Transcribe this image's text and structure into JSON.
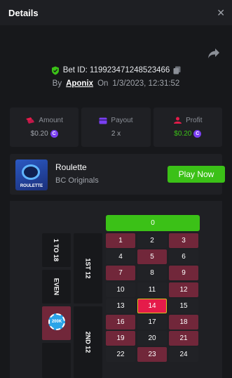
{
  "header": {
    "title": "Details",
    "close_glyph": "✕"
  },
  "bet": {
    "id_text": "Bet ID: 119923471248523466",
    "by_label": "By",
    "user": "Aponix",
    "on_label": "On",
    "date": "1/3/2023, 12:31:52"
  },
  "stats": {
    "amount": {
      "label": "Amount",
      "value": "$0.20"
    },
    "payout": {
      "label": "Payout",
      "value": "2 x"
    },
    "profit": {
      "label": "Profit",
      "value": "$0.20"
    }
  },
  "game": {
    "name": "Roulette",
    "provider": "BC Originals",
    "thumb_label": "ROULETTE",
    "play_label": "Play Now"
  },
  "board": {
    "zero": "0",
    "side_bets": [
      "1 TO 18",
      "EVEN"
    ],
    "dozens": [
      "1ST 12",
      "2ND 12"
    ],
    "chip_label": "200K",
    "selected": "14",
    "rows": [
      [
        {
          "n": "1",
          "c": "red"
        },
        {
          "n": "2",
          "c": "black"
        },
        {
          "n": "3",
          "c": "red"
        }
      ],
      [
        {
          "n": "4",
          "c": "black"
        },
        {
          "n": "5",
          "c": "red"
        },
        {
          "n": "6",
          "c": "black"
        }
      ],
      [
        {
          "n": "7",
          "c": "red"
        },
        {
          "n": "8",
          "c": "black"
        },
        {
          "n": "9",
          "c": "red"
        }
      ],
      [
        {
          "n": "10",
          "c": "black"
        },
        {
          "n": "11",
          "c": "black"
        },
        {
          "n": "12",
          "c": "red"
        }
      ],
      [
        {
          "n": "13",
          "c": "black"
        },
        {
          "n": "14",
          "c": "sel"
        },
        {
          "n": "15",
          "c": "black"
        }
      ],
      [
        {
          "n": "16",
          "c": "red"
        },
        {
          "n": "17",
          "c": "black"
        },
        {
          "n": "18",
          "c": "red"
        }
      ],
      [
        {
          "n": "19",
          "c": "red"
        },
        {
          "n": "20",
          "c": "black"
        },
        {
          "n": "21",
          "c": "red"
        }
      ],
      [
        {
          "n": "22",
          "c": "black"
        },
        {
          "n": "23",
          "c": "red"
        },
        {
          "n": "24",
          "c": "black"
        }
      ]
    ]
  },
  "colors": {
    "green": "#3bc117",
    "red_cell": "#71273a",
    "selected": "#e51b4a",
    "coin": "#7a3ff2"
  },
  "icons": [
    "close-icon",
    "share-icon",
    "shield-check-icon",
    "copy-icon",
    "amount-icon",
    "payout-icon",
    "profit-icon",
    "coin-icon"
  ]
}
